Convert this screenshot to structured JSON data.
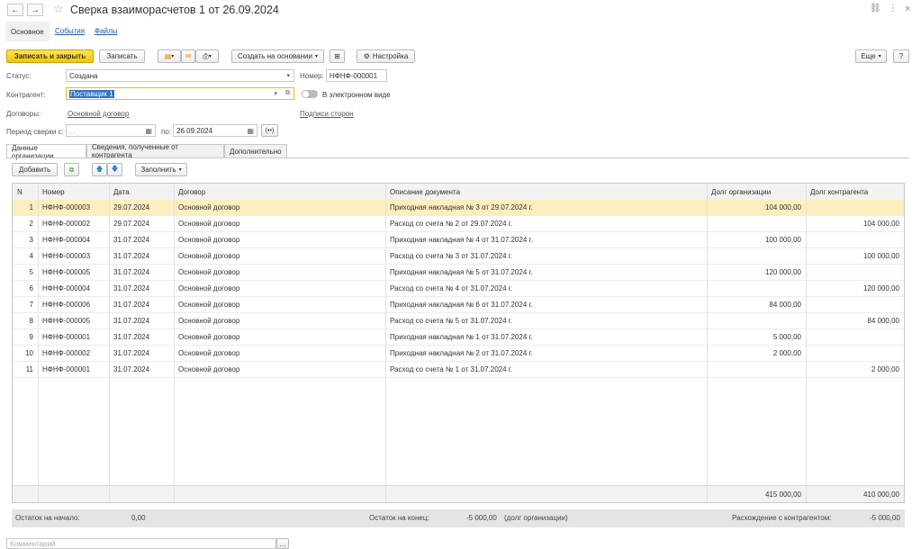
{
  "window": {
    "title": "Сверка взаиморасчетов 1 от 26.09.2024",
    "back_icon": "←",
    "forward_icon": "→",
    "star_icon": "☆",
    "link_icon": "🔗",
    "menu_icon": "⋮",
    "close_icon": "×"
  },
  "nav": {
    "main": "Основное",
    "events": "События",
    "files": "Файлы"
  },
  "toolbar": {
    "save_close": "Записать и закрыть",
    "save": "Записать",
    "create_based": "Создать на основании",
    "settings": "Настройка",
    "more": "Еще",
    "help": "?"
  },
  "form": {
    "status_label": "Статус:",
    "status_value": "Создана",
    "number_label": "Номер:",
    "number_value": "НФНФ-000001",
    "counterparty_label": "Контрагент:",
    "counterparty_value": "Поставщик 1",
    "electronic_label": "В электронном виде",
    "contracts_label": "Договоры:",
    "contracts_link": "Основной договор",
    "signatures_link": "Подписи сторон",
    "period_label": "Период сверки с:",
    "period_from": " .  .",
    "period_to_label": "по:",
    "period_to": "26.09.2024"
  },
  "tabs": [
    "Данные организации",
    "Сведения, полученные от контрагента",
    "Дополнительно"
  ],
  "table_toolbar": {
    "add": "Добавить",
    "fill": "Заполнить"
  },
  "table": {
    "columns": [
      "N",
      "Номер",
      "Дата",
      "Договор",
      "Описание документа",
      "Долг организации",
      "Долг контрагента"
    ],
    "rows": [
      {
        "n": "1",
        "number": "НФНФ-000003",
        "date": "29.07.2024",
        "contract": "Основной договор",
        "desc": "Приходная накладная № 3 от 29.07.2024 г.",
        "org_debt": "104 000,00",
        "cp_debt": ""
      },
      {
        "n": "2",
        "number": "НФНФ-000002",
        "date": "29.07.2024",
        "contract": "Основной договор",
        "desc": "Расход со счета № 2 от 29.07.2024 г.",
        "org_debt": "",
        "cp_debt": "104 000,00"
      },
      {
        "n": "3",
        "number": "НФНФ-000004",
        "date": "31.07.2024",
        "contract": "Основной договор",
        "desc": "Приходная накладная № 4 от 31.07.2024 г.",
        "org_debt": "100 000,00",
        "cp_debt": ""
      },
      {
        "n": "4",
        "number": "НФНФ-000003",
        "date": "31.07.2024",
        "contract": "Основной договор",
        "desc": "Расход со счета № 3 от 31.07.2024 г.",
        "org_debt": "",
        "cp_debt": "100 000,00"
      },
      {
        "n": "5",
        "number": "НФНФ-000005",
        "date": "31.07.2024",
        "contract": "Основной договор",
        "desc": "Приходная накладная № 5 от 31.07.2024 г.",
        "org_debt": "120 000,00",
        "cp_debt": ""
      },
      {
        "n": "6",
        "number": "НФНФ-000004",
        "date": "31.07.2024",
        "contract": "Основной договор",
        "desc": "Расход со счета № 4 от 31.07.2024 г.",
        "org_debt": "",
        "cp_debt": "120 000,00"
      },
      {
        "n": "7",
        "number": "НФНФ-000006",
        "date": "31.07.2024",
        "contract": "Основной договор",
        "desc": "Приходная накладная № 6 от 31.07.2024 г.",
        "org_debt": "84 000,00",
        "cp_debt": ""
      },
      {
        "n": "8",
        "number": "НФНФ-000005",
        "date": "31.07.2024",
        "contract": "Основной договор",
        "desc": "Расход со счета № 5 от 31.07.2024 г.",
        "org_debt": "",
        "cp_debt": "84 000,00"
      },
      {
        "n": "9",
        "number": "НФНФ-000001",
        "date": "31.07.2024",
        "contract": "Основной договор",
        "desc": "Приходная накладная № 1 от 31.07.2024 г.",
        "org_debt": "5 000,00",
        "cp_debt": ""
      },
      {
        "n": "10",
        "number": "НФНФ-000002",
        "date": "31.07.2024",
        "contract": "Основной договор",
        "desc": "Приходная накладная № 2 от 31.07.2024 г.",
        "org_debt": "2 000,00",
        "cp_debt": ""
      },
      {
        "n": "11",
        "number": "НФНФ-000001",
        "date": "31.07.2024",
        "contract": "Основной договор",
        "desc": "Расход со счета № 1 от 31.07.2024 г.",
        "org_debt": "",
        "cp_debt": "2 000,00"
      }
    ],
    "total_org": "415 000,00",
    "total_cp": "410 000,00"
  },
  "summary": {
    "start_label": "Остаток на начало:",
    "start_value": "0,00",
    "end_label": "Остаток на конец:",
    "end_value": "-5 000,00",
    "end_note": "(долг организации)",
    "diff_label": "Расхождение с контрагентом:",
    "diff_value": "-5 000,00"
  },
  "comment": {
    "placeholder": "Комментарий"
  },
  "colors": {
    "primary": "#f5c500",
    "link": "#1f57b5",
    "selected_row": "#fbeebf"
  }
}
